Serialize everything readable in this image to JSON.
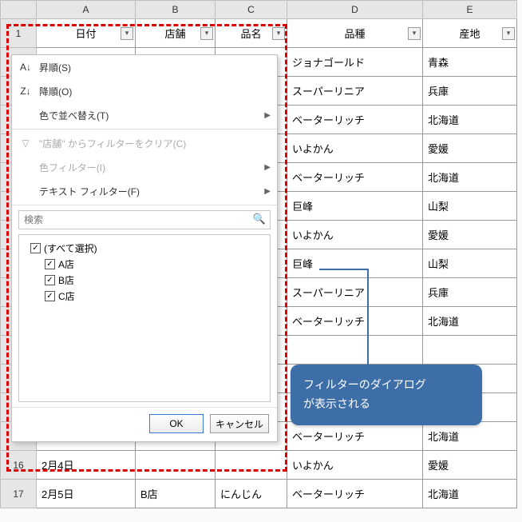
{
  "columns": [
    "A",
    "B",
    "C",
    "D",
    "E"
  ],
  "headerRow": {
    "A": "日付",
    "B": "店舗",
    "C": "品名",
    "D": "品種",
    "E": "産地"
  },
  "rows": [
    {
      "n": "",
      "D": "ジョナゴールド",
      "E": "青森"
    },
    {
      "n": "",
      "D": "スーパーリニア",
      "E": "兵庫"
    },
    {
      "n": "",
      "D": "ベーターリッチ",
      "E": "北海道"
    },
    {
      "n": "",
      "D": "いよかん",
      "E": "愛媛"
    },
    {
      "n": "",
      "D": "ベーターリッチ",
      "E": "北海道"
    },
    {
      "n": "",
      "D": "巨峰",
      "E": "山梨"
    },
    {
      "n": "",
      "D": "いよかん",
      "E": "愛媛"
    },
    {
      "n": "",
      "D": "巨峰",
      "E": "山梨"
    },
    {
      "n": "",
      "D": "スーパーリニア",
      "E": "兵庫"
    },
    {
      "n": "",
      "D": "ベーターリッチ",
      "E": "北海道"
    },
    {
      "n": "",
      "D": "",
      "E": ""
    },
    {
      "n": "",
      "D": "",
      "E": ""
    },
    {
      "n": "",
      "D": "",
      "E": ""
    },
    {
      "n": "",
      "D": "ベーターリッチ",
      "E": "北海道"
    },
    {
      "n": "16",
      "A": "2月4日",
      "B": "",
      "C": "",
      "D": "いよかん",
      "E": "愛媛"
    },
    {
      "n": "17",
      "A": "2月5日",
      "B": "B店",
      "C": "にんじん",
      "D": "ベーターリッチ",
      "E": "北海道"
    }
  ],
  "menu": {
    "sortAsc": "昇順(S)",
    "sortDesc": "降順(O)",
    "sortByColor": "色で並べ替え(T)",
    "clearFilter": "\"店舗\" からフィルターをクリア(C)",
    "colorFilter": "色フィルター(I)",
    "textFilter": "テキスト フィルター(F)",
    "searchPlaceholder": "検索",
    "selectAll": "(すべて選択)",
    "items": [
      "A店",
      "B店",
      "C店"
    ],
    "ok": "OK",
    "cancel": "キャンセル"
  },
  "callout": {
    "line1": "フィルターのダイアログ",
    "line2": "が表示される"
  }
}
